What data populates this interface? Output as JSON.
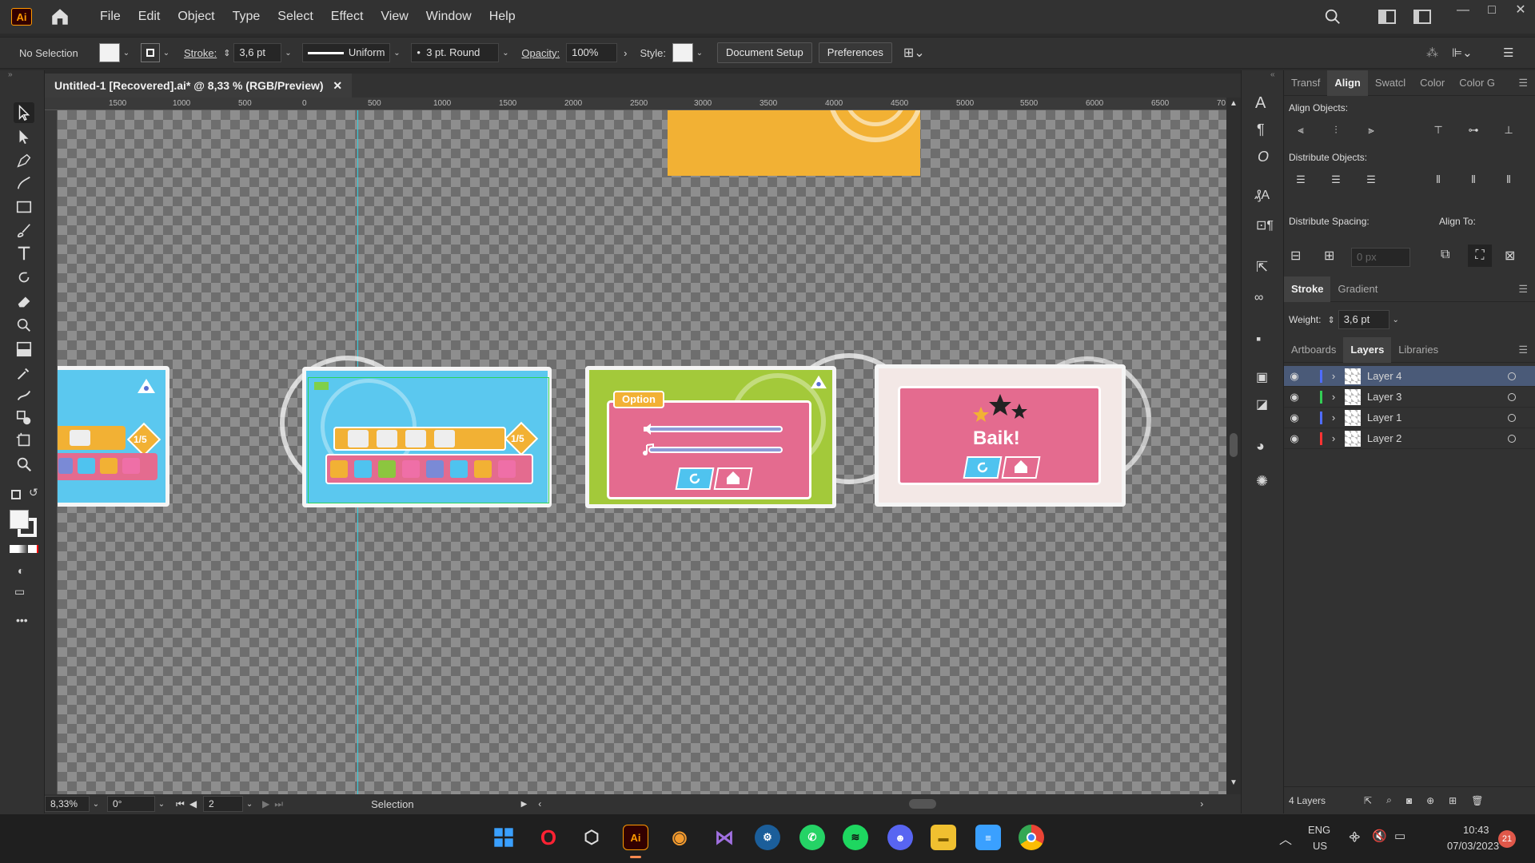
{
  "app": {
    "logo": "Ai",
    "menu": [
      "File",
      "Edit",
      "Object",
      "Type",
      "Select",
      "Effect",
      "View",
      "Window",
      "Help"
    ],
    "window_controls": [
      "—",
      "□",
      "✕"
    ]
  },
  "control": {
    "selection": "No Selection",
    "stroke_label": "Stroke:",
    "stroke_value": "3,6 pt",
    "profile": "Uniform",
    "brush": "3 pt. Round",
    "opacity_label": "Opacity:",
    "opacity_value": "100%",
    "style_label": "Style:",
    "doc_setup": "Document Setup",
    "preferences": "Preferences"
  },
  "doc_tab": {
    "title": "Untitled-1 [Recovered].ai* @ 8,33 % (RGB/Preview)",
    "close": "✕"
  },
  "ruler": {
    "ticks": [
      "1500",
      "1000",
      "500",
      "0",
      "500",
      "1000",
      "1500",
      "2000",
      "2500",
      "3000",
      "3500",
      "4000",
      "4500",
      "5000",
      "5500",
      "6000",
      "6500",
      "70"
    ]
  },
  "artboards": {
    "counter": "1/5",
    "option_title": "Option",
    "result_text": "Baik!"
  },
  "status": {
    "zoom": "8,33%",
    "rotation": "0°",
    "artboard_num": "2",
    "tool": "Selection"
  },
  "align_panel": {
    "tabs": [
      "Transf",
      "Align",
      "Swatcl",
      "Color",
      "Color G"
    ],
    "align_objects": "Align Objects:",
    "distribute_objects": "Distribute Objects:",
    "distribute_spacing": "Distribute Spacing:",
    "align_to": "Align To:",
    "spacing_value": "0 px"
  },
  "stroke_panel": {
    "tabs": [
      "Stroke",
      "Gradient"
    ],
    "weight_label": "Weight:",
    "weight_value": "3,6 pt"
  },
  "layers_panel": {
    "tabs": [
      "Artboards",
      "Layers",
      "Libraries"
    ],
    "layers": [
      {
        "name": "Layer 4",
        "color": "#4f6cff"
      },
      {
        "name": "Layer 3",
        "color": "#33cc55"
      },
      {
        "name": "Layer 1",
        "color": "#4f6cff"
      },
      {
        "name": "Layer 2",
        "color": "#ff3333"
      }
    ],
    "count": "4 Layers"
  },
  "taskbar": {
    "lang": "ENG",
    "region": "US",
    "time": "10:43",
    "date": "07/03/2023",
    "badge": "21"
  }
}
